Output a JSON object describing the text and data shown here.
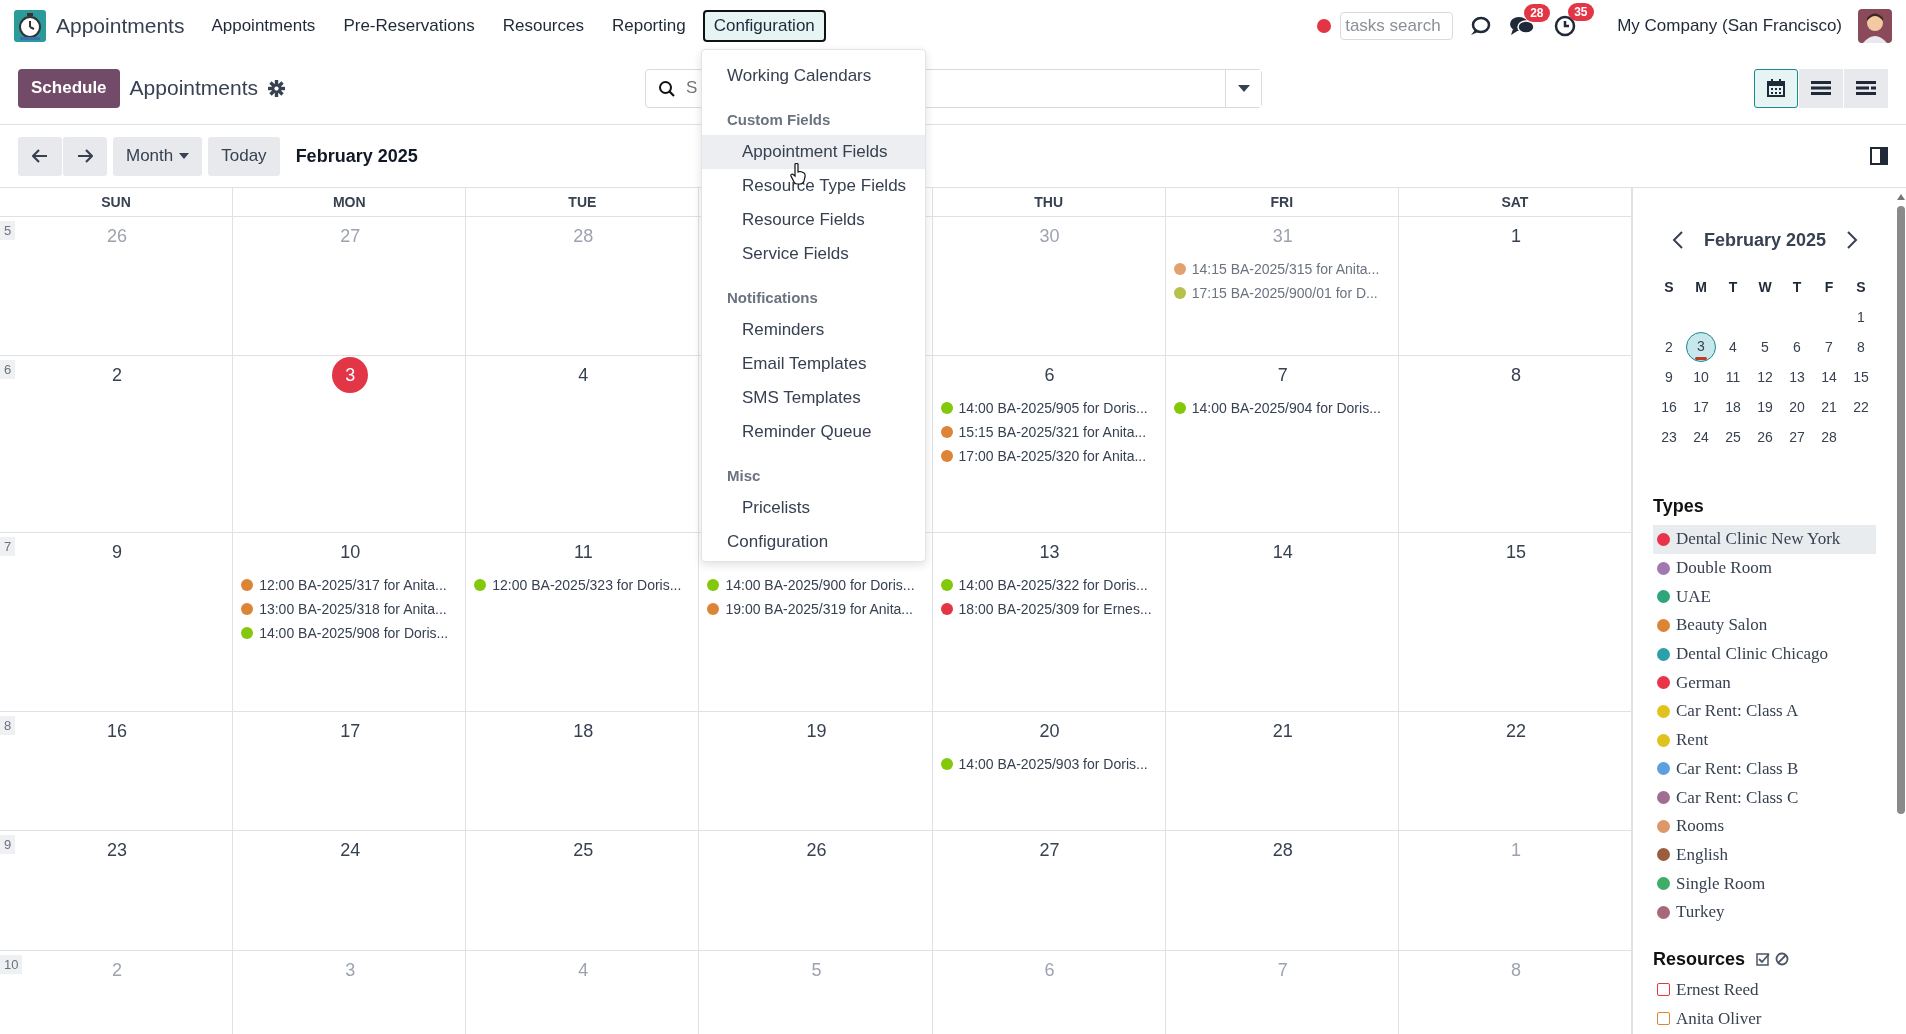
{
  "navbar": {
    "app_name": "Appointments",
    "menu": [
      {
        "label": "Appointments",
        "selected": false
      },
      {
        "label": "Pre-Reservations",
        "selected": false
      },
      {
        "label": "Resources",
        "selected": false
      },
      {
        "label": "Reporting",
        "selected": false
      },
      {
        "label": "Configuration",
        "selected": true
      }
    ],
    "tasks_search": {
      "placeholder": "tasks search"
    },
    "messages_badge": "28",
    "activities_badge": "35",
    "company": "My Company (San Francisco)"
  },
  "control_panel": {
    "primary_button": "Schedule",
    "title": "Appointments",
    "search": {
      "placeholder": "S"
    },
    "views": [
      {
        "kind": "calendar",
        "selected": true
      },
      {
        "kind": "list",
        "selected": false
      },
      {
        "kind": "gantt",
        "selected": false
      }
    ]
  },
  "toolbar": {
    "scale": "Month",
    "today": "Today",
    "period": "February 2025"
  },
  "calendar": {
    "weekdays": {
      "sun": "SUN",
      "mon": "MON",
      "tue": "TUE",
      "thu": "THU",
      "fri": "FRI",
      "sat": "SAT"
    },
    "weeks": [
      {
        "number": "5",
        "days": {
          "sun": {
            "date": "26",
            "muted": true,
            "today": false
          },
          "mon": {
            "date": "27",
            "muted": true,
            "today": false
          },
          "tue": {
            "date": "28",
            "muted": true,
            "today": false
          },
          "thu": {
            "date": "30",
            "muted": true,
            "today": false
          },
          "fri": {
            "date": "31",
            "muted": true,
            "today": false,
            "events": [
              {
                "text": "14:15 BA-2025/315 for Anita...",
                "color": "#e3a16f"
              },
              {
                "text": "17:15 BA-2025/900/01 for D...",
                "color": "#b6c04a"
              }
            ]
          },
          "sat": {
            "date": "1",
            "muted": false,
            "today": false
          }
        }
      },
      {
        "number": "6",
        "days": {
          "sun": {
            "date": "2",
            "muted": false,
            "today": false
          },
          "mon": {
            "date": "3",
            "muted": false,
            "today": true
          },
          "tue": {
            "date": "4",
            "muted": false,
            "today": false
          },
          "thu": {
            "date": "6",
            "muted": false,
            "today": false,
            "events": [
              {
                "text": "14:00 BA-2025/905 for Doris...",
                "color": "#84c80c"
              },
              {
                "text": "15:15 BA-2025/321 for Anita...",
                "color": "#dc8536"
              },
              {
                "text": "17:00 BA-2025/320 for Anita...",
                "color": "#dc8536"
              }
            ]
          },
          "fri": {
            "date": "7",
            "muted": false,
            "today": false,
            "events": [
              {
                "text": "14:00 BA-2025/904 for Doris...",
                "color": "#84c80c"
              }
            ]
          },
          "sat": {
            "date": "8",
            "muted": false,
            "today": false
          }
        }
      },
      {
        "number": "7",
        "days": {
          "sun": {
            "date": "9",
            "muted": false,
            "today": false
          },
          "mon": {
            "date": "10",
            "muted": false,
            "today": false,
            "events": [
              {
                "text": "12:00 BA-2025/317 for Anita...",
                "color": "#dc8536"
              },
              {
                "text": "13:00 BA-2025/318 for Anita...",
                "color": "#dc8536"
              },
              {
                "text": "14:00 BA-2025/908 for Doris...",
                "color": "#84c80c"
              }
            ]
          },
          "tue": {
            "date": "11",
            "muted": false,
            "today": false,
            "events": [
              {
                "text": "12:00 BA-2025/323 for Doris...",
                "color": "#84c80c"
              }
            ]
          },
          "wed": {
            "muted": false,
            "events": [
              {
                "text": "14:00 BA-2025/900 for Doris...",
                "color": "#84c80c"
              },
              {
                "text": "19:00 BA-2025/319 for Anita...",
                "color": "#dc8536"
              }
            ]
          },
          "thu": {
            "date": "13",
            "muted": false,
            "today": false,
            "events": [
              {
                "text": "14:00 BA-2025/322 for Doris...",
                "color": "#84c80c"
              },
              {
                "text": "18:00 BA-2025/309 for Ernes...",
                "color": "#e23546"
              }
            ]
          },
          "fri": {
            "date": "14",
            "muted": false,
            "today": false
          },
          "sat": {
            "date": "15",
            "muted": false,
            "today": false
          }
        }
      },
      {
        "number": "8",
        "days": {
          "sun": {
            "date": "16",
            "muted": false,
            "today": false
          },
          "mon": {
            "date": "17",
            "muted": false,
            "today": false
          },
          "tue": {
            "date": "18",
            "muted": false,
            "today": false
          },
          "wed": {
            "date": "19",
            "muted": false,
            "today": false
          },
          "thu": {
            "date": "20",
            "muted": false,
            "today": false,
            "events": [
              {
                "text": "14:00 BA-2025/903 for Doris...",
                "color": "#84c80c"
              }
            ]
          },
          "fri": {
            "date": "21",
            "muted": false,
            "today": false
          },
          "sat": {
            "date": "22",
            "muted": false,
            "today": false
          }
        }
      },
      {
        "number": "9",
        "days": {
          "sun": {
            "date": "23",
            "muted": false,
            "today": false
          },
          "mon": {
            "date": "24",
            "muted": false,
            "today": false
          },
          "tue": {
            "date": "25",
            "muted": false,
            "today": false
          },
          "wed": {
            "date": "26",
            "muted": false,
            "today": false
          },
          "thu": {
            "date": "27",
            "muted": false,
            "today": false
          },
          "fri": {
            "date": "28",
            "muted": false,
            "today": false
          },
          "sat": {
            "date": "1",
            "muted": true,
            "today": false
          }
        }
      },
      {
        "number": "10",
        "days": {
          "sun": {
            "date": "2",
            "muted": true,
            "today": false
          },
          "mon": {
            "date": "3",
            "muted": true,
            "today": false
          },
          "tue": {
            "date": "4",
            "muted": true,
            "today": false
          },
          "wed": {
            "date": "5",
            "muted": true,
            "today": false
          },
          "thu": {
            "date": "6",
            "muted": true,
            "today": false
          },
          "fri": {
            "date": "7",
            "muted": true,
            "today": false
          },
          "sat": {
            "date": "8",
            "muted": true,
            "today": false
          }
        }
      }
    ]
  },
  "config_menu": {
    "items": [
      {
        "kind": "item",
        "label": "Working Calendars",
        "selected": false
      },
      {
        "kind": "header",
        "label": "Custom Fields"
      },
      {
        "kind": "subitem",
        "label": "Appointment Fields",
        "selected": true
      },
      {
        "kind": "subitem",
        "label": "Resource Type Fields",
        "selected": false
      },
      {
        "kind": "subitem",
        "label": "Resource Fields",
        "selected": false
      },
      {
        "kind": "subitem",
        "label": "Service Fields",
        "selected": false
      },
      {
        "kind": "header",
        "label": "Notifications"
      },
      {
        "kind": "subitem",
        "label": "Reminders",
        "selected": false
      },
      {
        "kind": "subitem",
        "label": "Email Templates",
        "selected": false
      },
      {
        "kind": "subitem",
        "label": "SMS Templates",
        "selected": false
      },
      {
        "kind": "subitem",
        "label": "Reminder Queue",
        "selected": false
      },
      {
        "kind": "header",
        "label": "Misc"
      },
      {
        "kind": "subitem",
        "label": "Pricelists",
        "selected": false
      },
      {
        "kind": "item",
        "label": "Configuration",
        "selected": false
      }
    ]
  },
  "sidebar": {
    "mini_calendar": {
      "title": "February 2025",
      "weekdays": [
        "S",
        "M",
        "T",
        "W",
        "T",
        "F",
        "S"
      ],
      "weeks": [
        [
          {
            "label": "1",
            "selected": false,
            "today": false
          }
        ],
        [
          {
            "label": "2",
            "selected": false,
            "today": false
          },
          {
            "label": "3",
            "selected": true,
            "today": true
          },
          {
            "label": "4",
            "selected": false,
            "today": false
          },
          {
            "label": "5",
            "selected": false,
            "today": false
          },
          {
            "label": "6",
            "selected": false,
            "today": false
          },
          {
            "label": "7",
            "selected": false,
            "today": false
          },
          {
            "label": "8",
            "selected": false,
            "today": false
          }
        ],
        [
          {
            "label": "9",
            "selected": false,
            "today": false
          },
          {
            "label": "10",
            "selected": false,
            "today": false
          },
          {
            "label": "11",
            "selected": false,
            "today": false
          },
          {
            "label": "12",
            "selected": false,
            "today": false
          },
          {
            "label": "13",
            "selected": false,
            "today": false
          },
          {
            "label": "14",
            "selected": false,
            "today": false
          },
          {
            "label": "15",
            "selected": false,
            "today": false
          }
        ],
        [
          {
            "label": "16",
            "selected": false,
            "today": false
          },
          {
            "label": "17",
            "selected": false,
            "today": false
          },
          {
            "label": "18",
            "selected": false,
            "today": false
          },
          {
            "label": "19",
            "selected": false,
            "today": false
          },
          {
            "label": "20",
            "selected": false,
            "today": false
          },
          {
            "label": "21",
            "selected": false,
            "today": false
          },
          {
            "label": "22",
            "selected": false,
            "today": false
          }
        ],
        [
          {
            "label": "23",
            "selected": false,
            "today": false
          },
          {
            "label": "24",
            "selected": false,
            "today": false
          },
          {
            "label": "25",
            "selected": false,
            "today": false
          },
          {
            "label": "26",
            "selected": false,
            "today": false
          },
          {
            "label": "27",
            "selected": false,
            "today": false
          },
          {
            "label": "28",
            "selected": false,
            "today": false
          }
        ]
      ]
    },
    "types_title": "Types",
    "types": [
      {
        "label": "Dental Clinic New York",
        "color": "#e8334a",
        "selected": true
      },
      {
        "label": "Double Room",
        "color": "#a178b0",
        "selected": false
      },
      {
        "label": "UAE",
        "color": "#2ea57a",
        "selected": false
      },
      {
        "label": "Beauty Salon",
        "color": "#dc8536",
        "selected": false
      },
      {
        "label": "Dental Clinic Chicago",
        "color": "#2c9faa",
        "selected": false
      },
      {
        "label": "German",
        "color": "#e8334a",
        "selected": false
      },
      {
        "label": "Car Rent: Class A",
        "color": "#e0c21e",
        "selected": false
      },
      {
        "label": "Rent",
        "color": "#e0c21e",
        "selected": false
      },
      {
        "label": "Car Rent: Class B",
        "color": "#5ca0e0",
        "selected": false
      },
      {
        "label": "Car Rent: Class C",
        "color": "#a06e90",
        "selected": false
      },
      {
        "label": "Rooms",
        "color": "#dc9868",
        "selected": false
      },
      {
        "label": "English",
        "color": "#9a5e3e",
        "selected": false
      },
      {
        "label": "Single Room",
        "color": "#40ac68",
        "selected": false
      },
      {
        "label": "Turkey",
        "color": "#a86878",
        "selected": false
      }
    ],
    "resources_title": "Resources",
    "resources": [
      {
        "label": "Ernest Reed",
        "color": "#e23546",
        "checked": false
      },
      {
        "label": "Anita Oliver",
        "color": "#dc8536",
        "checked": false
      }
    ]
  }
}
